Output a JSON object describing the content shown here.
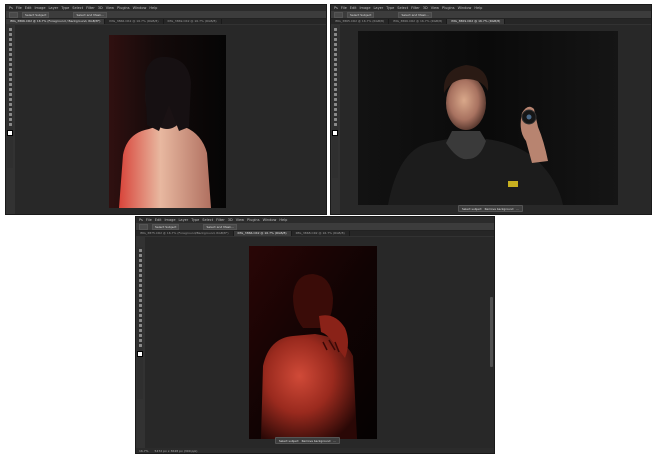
{
  "menu": [
    "Ps",
    "File",
    "Edit",
    "Image",
    "Layer",
    "Type",
    "Select",
    "Filter",
    "3D",
    "View",
    "Plugins",
    "Window",
    "Help"
  ],
  "windows": [
    {
      "tabs": [
        "IMG_3866.CR2 @ 16.7% (Foreground / Background, RGB/8*)",
        "IMG_3866.CR2 @ 16.7% (RGB/8)",
        "IMG_3869.CR2 @ 16.7% (RGB/8)"
      ],
      "options": [
        "Select Subject",
        "Select and Mask..."
      ]
    },
    {
      "tabs": [
        "IMG_3865.CR2 @ 16.7% (RGB/8)",
        "IMG_3866.CR2 @ 16.7% (RGB/8)",
        "IMG_3869.CR2 @ 16.7% (RGB/8)"
      ],
      "options": [
        "Select Subject",
        "Select and Mask..."
      ],
      "floatbar": [
        "Select subject",
        "Remove background"
      ]
    },
    {
      "tabs": [
        "IMG_3875.CR2 @ 16.7% (Foreground/Background, RGB/8*)",
        "IMG_3866.CR2 @ 16.7% (RGB/8)",
        "IMG_3868.CR2 @ 16.7% (RGB/8)"
      ],
      "options": [
        "Select Subject",
        "Select and Mask..."
      ],
      "floatbar": [
        "Select subject",
        "Remove background"
      ],
      "status": [
        "16.7%",
        "5472 px x 3648 px (300 ppi)"
      ]
    }
  ]
}
